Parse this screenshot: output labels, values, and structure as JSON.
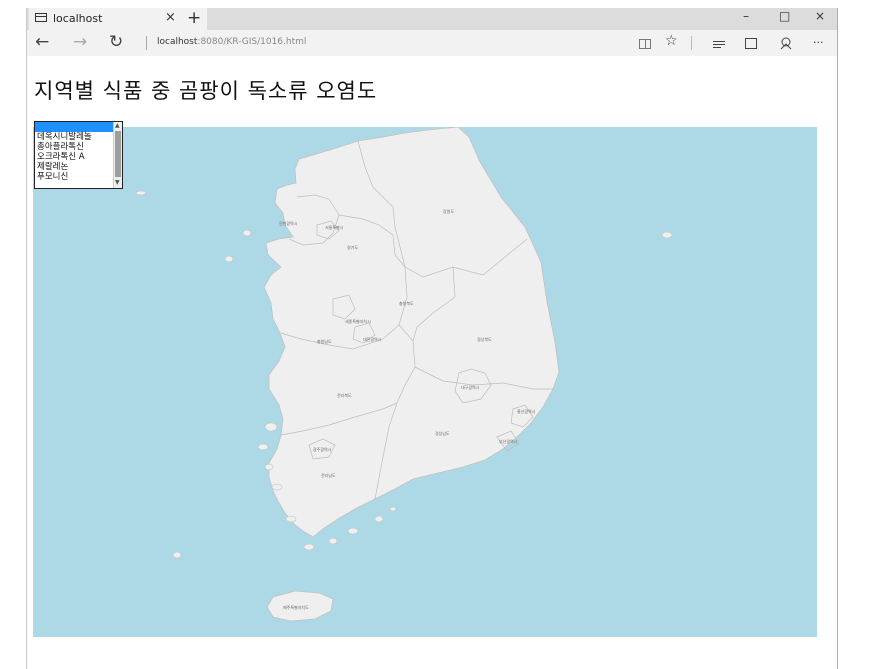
{
  "browser": {
    "tab_title": "localhost",
    "tab_close": "×",
    "new_tab": "+",
    "window_controls": {
      "minimize": "–",
      "maximize": "□",
      "close": "×"
    },
    "nav": {
      "back": "←",
      "forward": "→",
      "refresh": "↻"
    },
    "url_host": "localhost",
    "url_rest": ":8080/KR-GIS/1016.html",
    "tools": {
      "favorite": "☆",
      "more": "···"
    }
  },
  "page": {
    "title": "지역별 식품 중 곰팡이 독소류 오염도"
  },
  "toxin_list": {
    "options": [
      "",
      "데옥시니발레놀",
      "총아플라톡신",
      "오크라톡신 A",
      "제랄레논",
      "푸모니신"
    ],
    "selected_index": 0
  },
  "map": {
    "ocean_color": "#add8e6",
    "land_color": "#efefef",
    "region_labels": [
      "강원도",
      "경기도",
      "서울특별시",
      "인천광역시",
      "충청북도",
      "충청남도",
      "세종특별자치시",
      "대전광역시",
      "경상북도",
      "대구광역시",
      "전라북도",
      "경상남도",
      "울산광역시",
      "부산광역시",
      "광주광역시",
      "전라남도",
      "제주특별자치도"
    ]
  }
}
